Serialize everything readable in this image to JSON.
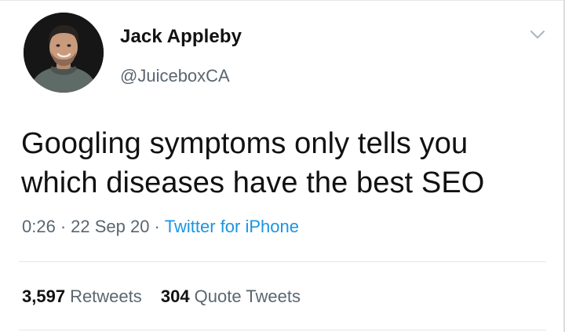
{
  "author": {
    "display_name": "Jack Appleby",
    "handle": "@JuiceboxCA",
    "avatar_icon": "user-avatar"
  },
  "menu_icon": "chevron-down-icon",
  "tweet": {
    "text": "Googling symptoms only tells you which diseases have the best SEO",
    "time": "0:26",
    "date": "22 Sep 20",
    "separator": "·",
    "source": "Twitter for iPhone"
  },
  "stats": {
    "retweets_count": "3,597",
    "retweets_label": "Retweets",
    "quotes_count": "304",
    "quotes_label": "Quote Tweets"
  },
  "colors": {
    "link": "#1b95e0",
    "secondary_text": "#5b6670",
    "primary_text": "#111111",
    "divider": "#e1e8ed"
  }
}
